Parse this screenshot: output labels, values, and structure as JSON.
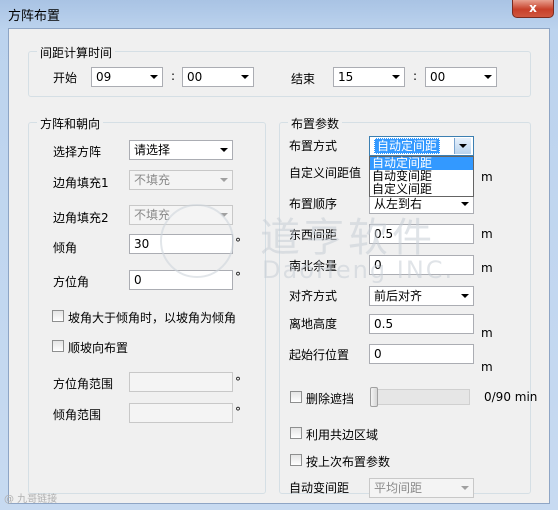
{
  "window": {
    "title": "方阵布置",
    "close_label": "x"
  },
  "time_group": {
    "legend": "间距计算时间",
    "start_label": "开始",
    "start_hour": "09",
    "start_min": "00",
    "colon": ":",
    "end_label": "结束",
    "end_hour": "15",
    "end_min": "00"
  },
  "array_group": {
    "legend": "方阵和朝向",
    "select_array_label": "选择方阵",
    "select_array_value": "请选择",
    "corner_fill1_label": "边角填充1",
    "corner_fill1_value": "不填充",
    "corner_fill2_label": "边角填充2",
    "corner_fill2_value": "不填充",
    "tilt_label": "倾角",
    "tilt_value": "30",
    "azimuth_label": "方位角",
    "azimuth_value": "0",
    "degree_unit": "°",
    "slope_check_label": "坡角大于倾角时，以坡角为倾角",
    "along_slope_label": "顺坡向布置",
    "azimuth_range_label": "方位角范围",
    "tilt_range_label": "倾角范围"
  },
  "layout_group": {
    "legend": "布置参数",
    "method_label": "布置方式",
    "method_value": "自动定间距",
    "method_options": [
      "自动定间距",
      "自动变间距",
      "自定义间距"
    ],
    "custom_spacing_label": "自定义间距值",
    "order_label": "布置顺序",
    "order_value": "从左到右",
    "ew_spacing_label": "东西间距",
    "ew_spacing_value": "0.5",
    "ns_margin_label": "南北余量",
    "ns_margin_value": "0",
    "align_label": "对齐方式",
    "align_value": "前后对齐",
    "ground_height_label": "离地高度",
    "ground_height_value": "0.5",
    "start_row_label": "起始行位置",
    "start_row_value": "0",
    "unit_m": "m",
    "remove_shade_label": "删除遮挡",
    "slider_range": "0/90 min",
    "slider_value": 0,
    "use_shared_label": "利用共边区域",
    "last_params_label": "按上次布置参数",
    "auto_var_label": "自动变间距",
    "auto_var_value": "平均间距"
  },
  "watermark": {
    "text1": "道亨软件",
    "text2": "DaoHeng INC.",
    "bottom": "@ 九哥链接"
  }
}
